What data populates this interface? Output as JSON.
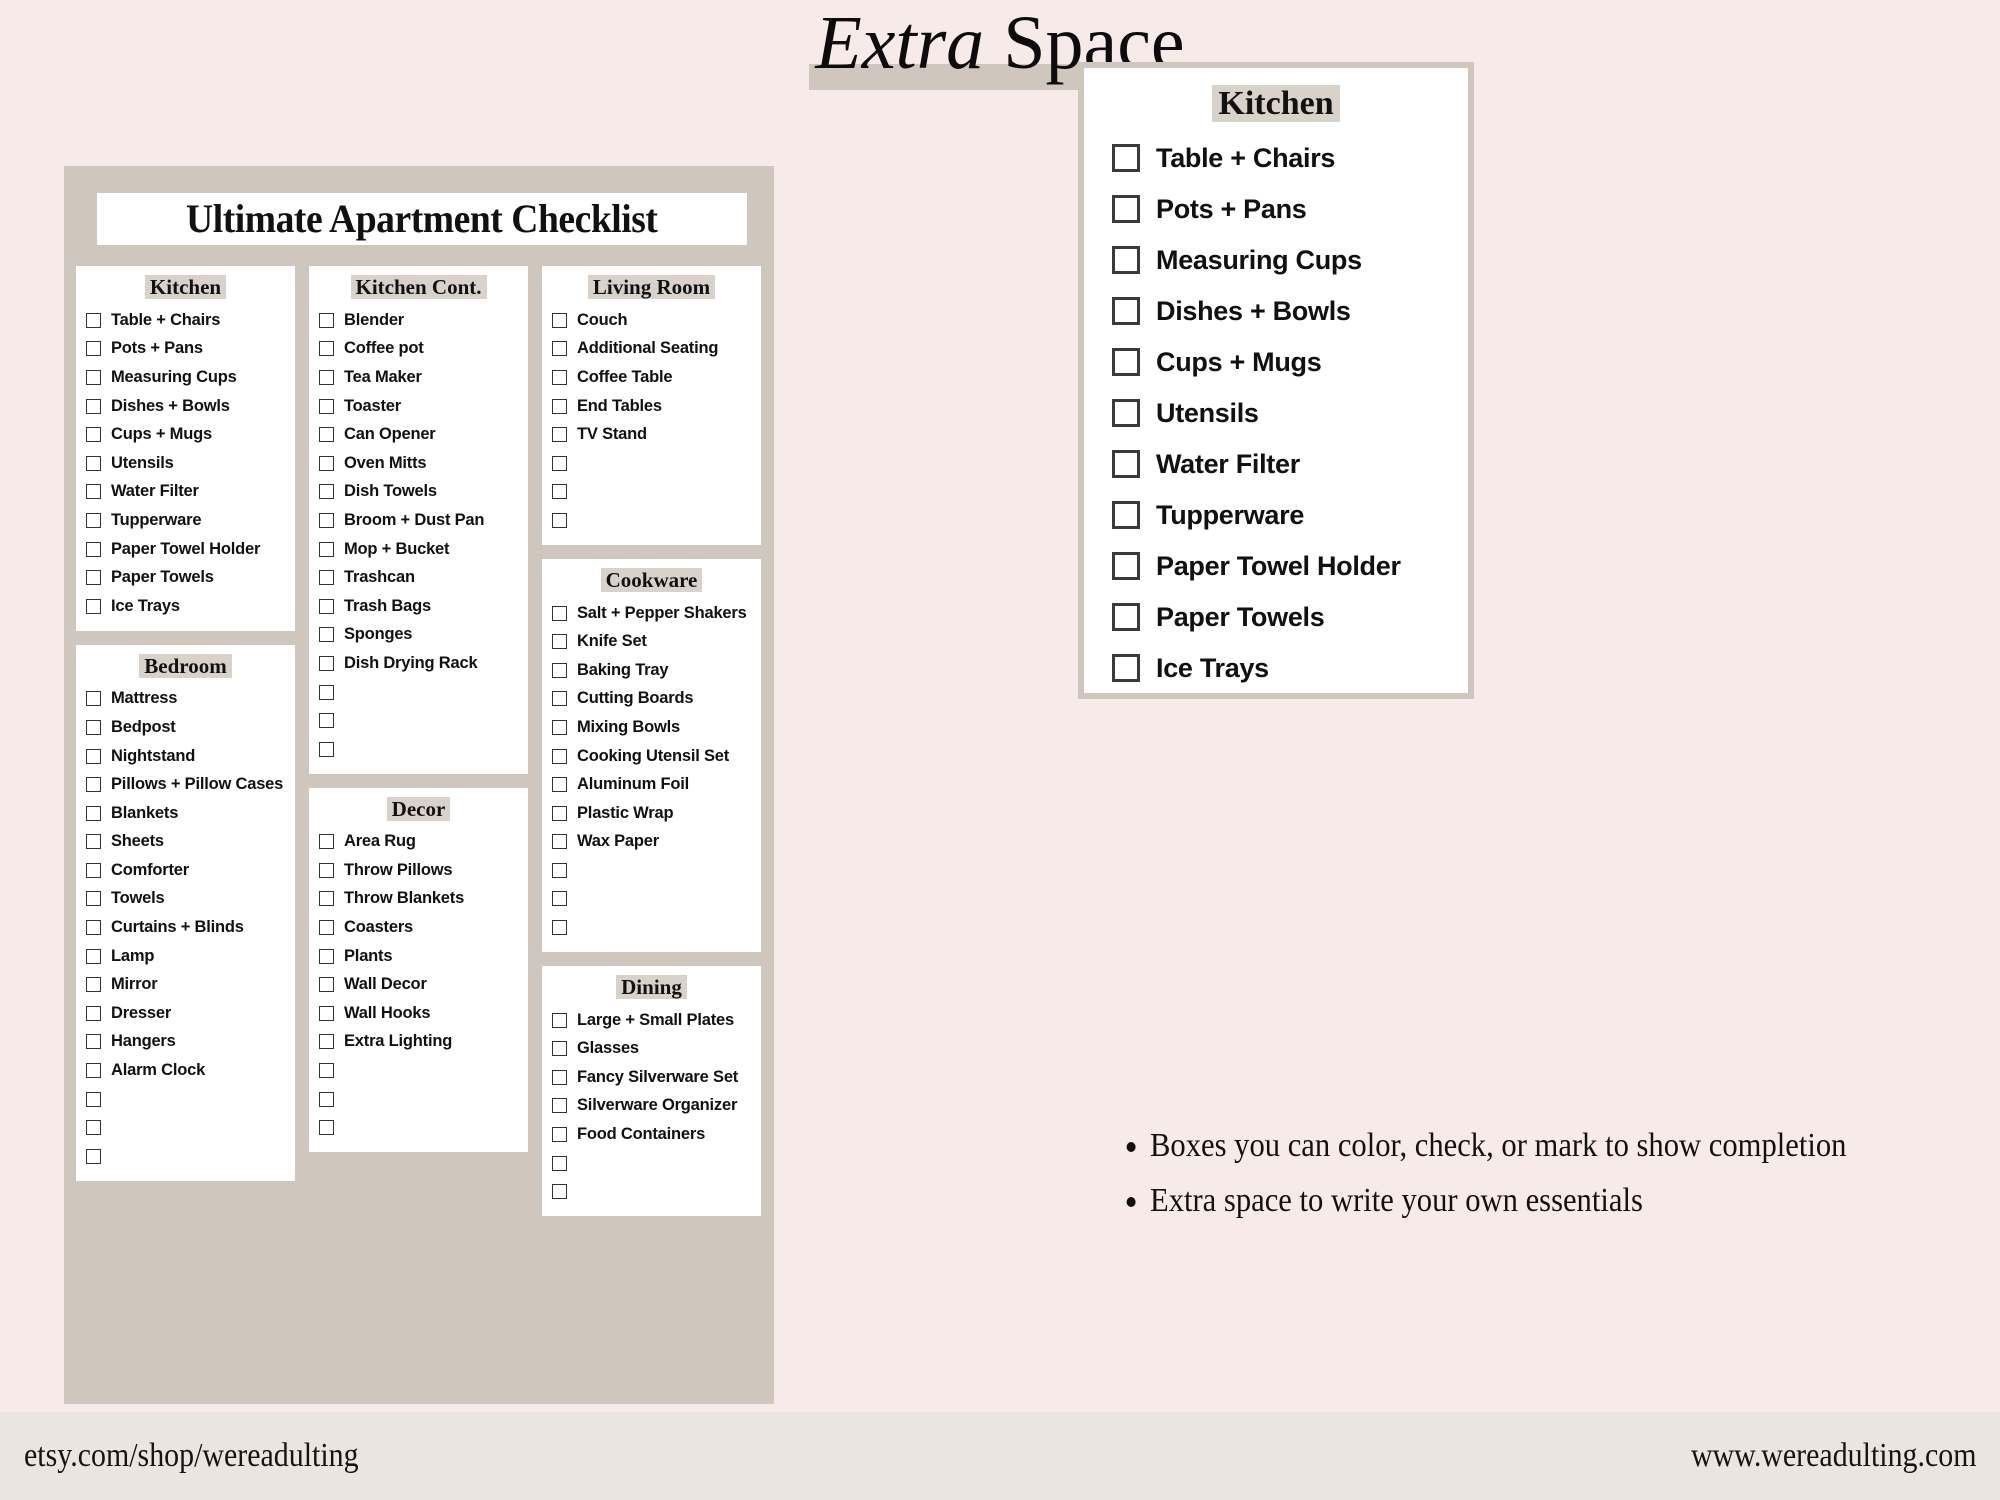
{
  "title": {
    "emphasis": "Extra",
    "rest": " Space"
  },
  "card": {
    "heading": "Ultimate Apartment Checklist",
    "columns": [
      {
        "panels": [
          {
            "heading": "Kitchen",
            "items": [
              "Table + Chairs",
              "Pots + Pans",
              "Measuring Cups",
              "Dishes + Bowls",
              "Cups + Mugs",
              "Utensils",
              "Water Filter",
              "Tupperware",
              "Paper Towel Holder",
              "Paper Towels",
              "Ice Trays"
            ],
            "blanks": 0
          },
          {
            "heading": "Bedroom",
            "items": [
              "Mattress",
              "Bedpost",
              "Nightstand",
              "Pillows + Pillow Cases",
              "Blankets",
              "Sheets",
              "Comforter",
              "Towels",
              "Curtains + Blinds",
              "Lamp",
              "Mirror",
              "Dresser",
              "Hangers",
              "Alarm Clock"
            ],
            "blanks": 3
          }
        ]
      },
      {
        "panels": [
          {
            "heading": "Kitchen Cont.",
            "items": [
              "Blender",
              "Coffee pot",
              "Tea Maker",
              "Toaster",
              "Can Opener",
              "Oven Mitts",
              "Dish Towels",
              "Broom + Dust Pan",
              "Mop + Bucket",
              "Trashcan",
              "Trash Bags",
              "Sponges",
              "Dish Drying Rack"
            ],
            "blanks": 3
          },
          {
            "heading": "Decor",
            "items": [
              "Area Rug",
              "Throw Pillows",
              "Throw Blankets",
              "Coasters",
              "Plants",
              "Wall Decor",
              "Wall Hooks",
              "Extra Lighting"
            ],
            "blanks": 3
          }
        ]
      },
      {
        "panels": [
          {
            "heading": "Living Room",
            "items": [
              "Couch",
              "Additional Seating",
              "Coffee Table",
              "End Tables",
              "TV Stand"
            ],
            "blanks": 3
          },
          {
            "heading": "Cookware",
            "items": [
              "Salt + Pepper Shakers",
              "Knife Set",
              "Baking Tray",
              "Cutting Boards",
              "Mixing Bowls",
              "Cooking Utensil Set",
              "Aluminum Foil",
              "Plastic Wrap",
              "Wax Paper"
            ],
            "blanks": 3
          },
          {
            "heading": "Dining",
            "items": [
              "Large + Small Plates",
              "Glasses",
              "Fancy Silverware Set",
              "Silverware Organizer",
              "Food Containers"
            ],
            "blanks": 2
          }
        ]
      }
    ]
  },
  "kitchen_panel": {
    "heading": "Kitchen",
    "items": [
      "Table + Chairs",
      "Pots + Pans",
      "Measuring Cups",
      "Dishes + Bowls",
      "Cups + Mugs",
      "Utensils",
      "Water Filter",
      "Tupperware",
      "Paper Towel Holder",
      "Paper Towels",
      "Ice Trays"
    ]
  },
  "bullets": [
    "Boxes you can color, check, or mark to show completion",
    "Extra space to write your own essentials"
  ],
  "footer": {
    "left": "etsy.com/shop/wereadulting",
    "right": "www.wereadulting.com"
  },
  "colors": {
    "background": "#f6ebe9",
    "card": "#cfc6bd",
    "highlight": "#d9d2cb",
    "footer": "#eae5e0",
    "ink": "#111111"
  }
}
